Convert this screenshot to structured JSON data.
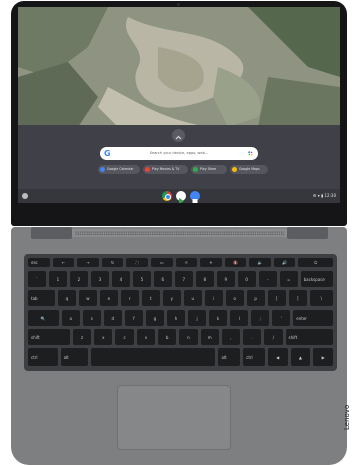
{
  "screen": {
    "search_placeholder": "Search your device, apps, web...",
    "google_letter": "G",
    "chips": [
      {
        "label": "Google Calendar",
        "color": "#4285f4"
      },
      {
        "label": "Play Movies & TV",
        "color": "#ea4335"
      },
      {
        "label": "Play Store",
        "color": "#34a853"
      },
      {
        "label": "Google Maps",
        "color": "#fbbc04"
      }
    ],
    "shelf_apps": [
      {
        "icon": "chrome-icon",
        "color": "#db4437"
      },
      {
        "icon": "play-store-icon",
        "color": "#ffffff"
      },
      {
        "icon": "files-icon",
        "color": "#4285f4"
      }
    ],
    "tray_time": "12:30"
  },
  "keyboard": {
    "rows": [
      [
        "esc",
        "←",
        "→",
        "↻",
        "⛶",
        "▭",
        "☼",
        "☀",
        "🔇",
        "🔉",
        "🔊",
        "⏻"
      ],
      [
        "`",
        "1",
        "2",
        "3",
        "4",
        "5",
        "6",
        "7",
        "8",
        "9",
        "0",
        "-",
        "=",
        "backspace"
      ],
      [
        "tab",
        "q",
        "w",
        "e",
        "r",
        "t",
        "y",
        "u",
        "i",
        "o",
        "p",
        "[",
        "]",
        "\\"
      ],
      [
        "🔍",
        "a",
        "s",
        "d",
        "f",
        "g",
        "h",
        "j",
        "k",
        "l",
        ";",
        "'",
        "enter"
      ],
      [
        "shift",
        "z",
        "x",
        "c",
        "v",
        "b",
        "n",
        "m",
        ",",
        ".",
        "/",
        "shift"
      ],
      [
        "ctrl",
        "alt",
        "",
        "alt",
        "ctrl",
        "◀",
        "▲",
        "▶"
      ]
    ]
  },
  "brand": "Lenovo"
}
